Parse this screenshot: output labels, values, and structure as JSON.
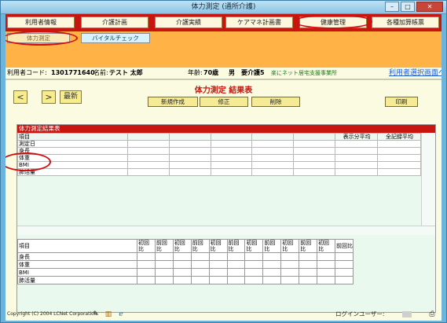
{
  "window": {
    "title": "体力測定 (通所介護)",
    "minimize": "–",
    "maximize": "□",
    "close": "✕"
  },
  "top_tabs": [
    "利用者情報",
    "介護計画",
    "介護実績",
    "ケアマネ計画書",
    "健康管理",
    "各種加算帳票"
  ],
  "sub_tabs": [
    "体力測定",
    "バイタルチェック"
  ],
  "info": {
    "user_code_label": "利用者コード:",
    "user_code": "1301771640",
    "name_label": "名前:",
    "name": "テスト 太郎",
    "age_label": "年齢:",
    "age": "70歳",
    "sex": "男",
    "care_level": "要介護5",
    "office": "楽にネット居宅支援事業所",
    "select_link": "利用者選択画面へ"
  },
  "heading": "体力測定 結果表",
  "nav": {
    "prev": "<",
    "next": ">",
    "latest": "最新"
  },
  "actions": {
    "new": "新規作成",
    "edit": "修正",
    "delete": "削除",
    "print": "印刷"
  },
  "results_panel": {
    "title": "体力測定結果表",
    "col_item": "項目",
    "col_avg": "表示分平均",
    "col_all_avg": "全記録平均",
    "rows": [
      "測定日",
      "身長",
      "体重",
      "BMI",
      "肺活量"
    ]
  },
  "compare_table": {
    "col_item": "項目",
    "pairs": [
      {
        "first": "初回比",
        "prev": "前回比"
      },
      {
        "first": "初回比",
        "prev": "前回比"
      },
      {
        "first": "初回比",
        "prev": "前回比"
      },
      {
        "first": "初回比",
        "prev": "前回比"
      },
      {
        "first": "初回比",
        "prev": "前回比"
      },
      {
        "first": "初回比",
        "prev": "前回比"
      }
    ],
    "rows": [
      "身長",
      "体重",
      "BMI",
      "肺活量"
    ]
  },
  "footer": {
    "copyright": "Copyright (C) 2004 LCNet Corporation",
    "login_label": "ログインユーザー:",
    "icons": [
      "pen-icon",
      "book-icon",
      "ie-icon",
      "printer-icon"
    ]
  },
  "colors": {
    "accent_red": "#c8150f",
    "sub_orange": "#ffb347",
    "panel_bg": "#fbfbe2",
    "button_yellow": "#f5eb94"
  }
}
